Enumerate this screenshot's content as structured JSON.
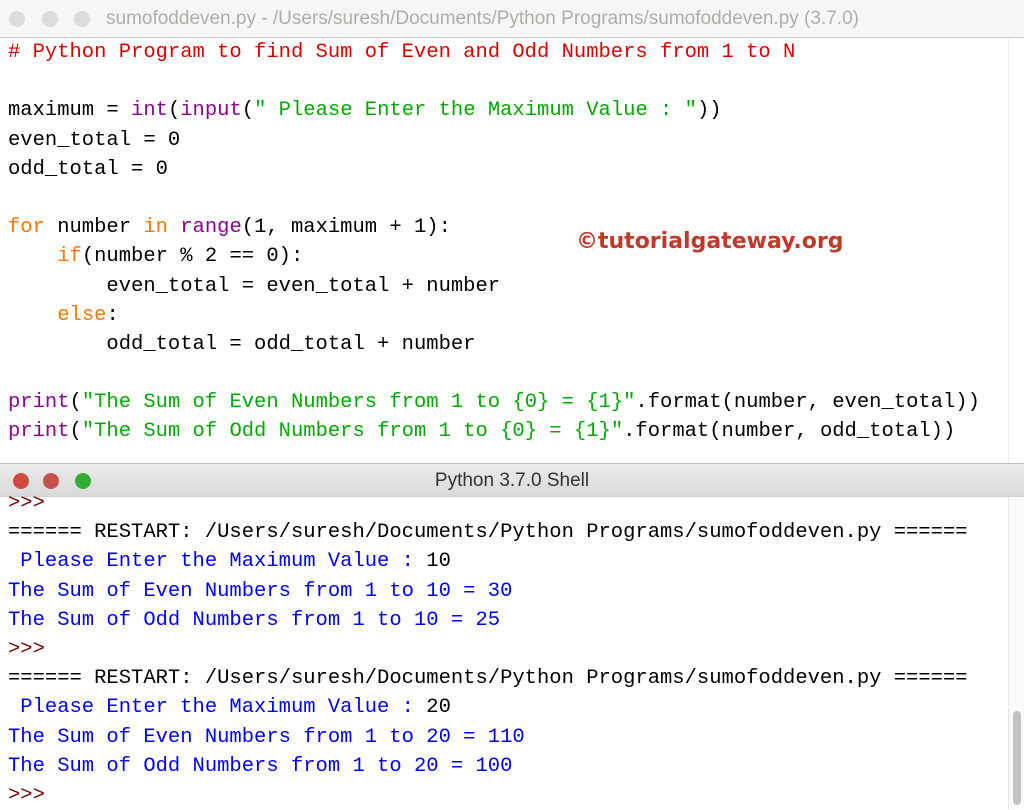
{
  "editor": {
    "title": "sumofoddeven.py - /Users/suresh/Documents/Python Programs/sumofoddeven.py (3.7.0)",
    "watermark": "©tutorialgateway.org",
    "lines": [
      [
        [
          "# Python Program to find Sum of Even and Odd Numbers from 1 to N",
          "cm"
        ]
      ],
      [],
      [
        [
          "maximum = ",
          ""
        ],
        [
          "int",
          "bi"
        ],
        [
          "(",
          ""
        ],
        [
          "input",
          "bi"
        ],
        [
          "(",
          ""
        ],
        [
          "\" Please Enter the Maximum Value : \"",
          "str"
        ],
        [
          "))",
          ""
        ]
      ],
      [
        [
          "even_total = 0",
          ""
        ]
      ],
      [
        [
          "odd_total = 0",
          ""
        ]
      ],
      [],
      [
        [
          "for",
          "kw"
        ],
        [
          " number ",
          ""
        ],
        [
          "in",
          "kw"
        ],
        [
          " ",
          ""
        ],
        [
          "range",
          "bi"
        ],
        [
          "(1, maximum + 1):",
          ""
        ]
      ],
      [
        [
          "    ",
          ""
        ],
        [
          "if",
          "kw"
        ],
        [
          "(number % 2 == 0):",
          ""
        ]
      ],
      [
        [
          "        even_total = even_total + number",
          ""
        ]
      ],
      [
        [
          "    ",
          ""
        ],
        [
          "else",
          "kw"
        ],
        [
          ":",
          ""
        ]
      ],
      [
        [
          "        odd_total = odd_total + number",
          ""
        ]
      ],
      [],
      [
        [
          "print",
          "bi"
        ],
        [
          "(",
          ""
        ],
        [
          "\"The Sum of Even Numbers from 1 to {0} = {1}\"",
          "str"
        ],
        [
          ".format(number, even_total))",
          ""
        ]
      ],
      [
        [
          "print",
          "bi"
        ],
        [
          "(",
          ""
        ],
        [
          "\"The Sum of Odd Numbers from 1 to {0} = {1}\"",
          "str"
        ],
        [
          ".format(number, odd_total))",
          ""
        ]
      ]
    ]
  },
  "shell": {
    "title": "Python 3.7.0 Shell",
    "lines": [
      [
        [
          ">>>",
          "pr"
        ]
      ],
      [
        [
          "====== RESTART: /Users/suresh/Documents/Python Programs/sumofoddeven.py ======",
          ""
        ]
      ],
      [
        [
          " Please Enter the Maximum Value : ",
          "out"
        ],
        [
          "10",
          ""
        ]
      ],
      [
        [
          "The Sum of Even Numbers from 1 to 10 = 30",
          "out"
        ]
      ],
      [
        [
          "The Sum of Odd Numbers from 1 to 10 = 25",
          "out"
        ]
      ],
      [
        [
          ">>>",
          "pr"
        ]
      ],
      [
        [
          "====== RESTART: /Users/suresh/Documents/Python Programs/sumofoddeven.py ======",
          ""
        ]
      ],
      [
        [
          " Please Enter the Maximum Value : ",
          "out"
        ],
        [
          "20",
          ""
        ]
      ],
      [
        [
          "The Sum of Even Numbers from 1 to 20 = 110",
          "out"
        ]
      ],
      [
        [
          "The Sum of Odd Numbers from 1 to 20 = 100",
          "out"
        ]
      ],
      [
        [
          ">>>",
          "pr"
        ]
      ]
    ]
  },
  "colors": {
    "close": "#e0443e",
    "minimize": "#dea123",
    "zoom": "#1aab29",
    "inactive": "#d6d6d6"
  }
}
